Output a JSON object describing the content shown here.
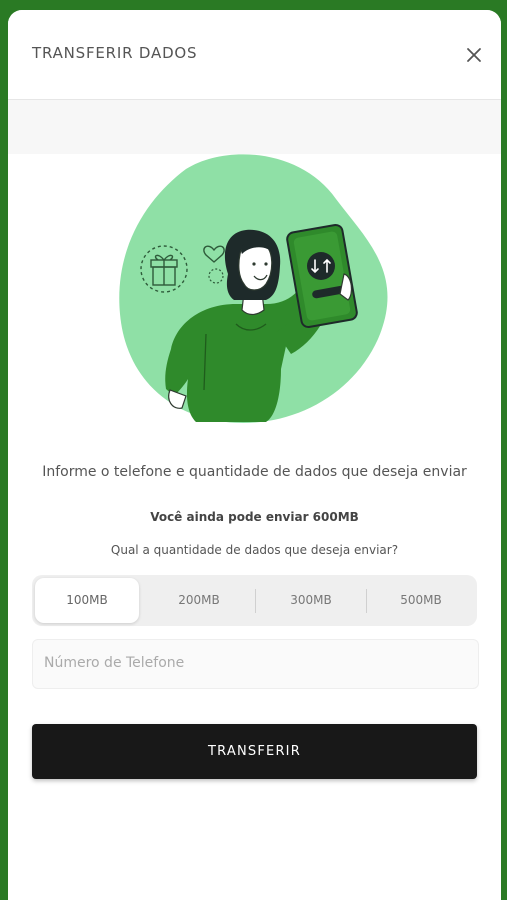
{
  "modal": {
    "title": "TRANSFERIR DADOS",
    "close_icon": "close-icon"
  },
  "illustration": {
    "name": "woman-holding-phone-transfer-illustration",
    "colors": {
      "blob": "#8fe0a6",
      "shirt": "#2f8a2b",
      "hair": "#1e2a2a"
    }
  },
  "content": {
    "instruction": "Informe o telefone e quantidade de dados que deseja enviar",
    "remaining": "Você ainda pode enviar 600MB",
    "question": "Qual a quantidade de dados que deseja enviar?"
  },
  "amounts": {
    "selected": "100MB",
    "options": [
      "100MB",
      "200MB",
      "300MB",
      "500MB"
    ]
  },
  "phone": {
    "placeholder": "Número de Telefone",
    "value": ""
  },
  "submit": {
    "label": "TRANSFERIR"
  },
  "colors": {
    "brand_green": "#2a7a24",
    "button_bg": "#181818"
  }
}
